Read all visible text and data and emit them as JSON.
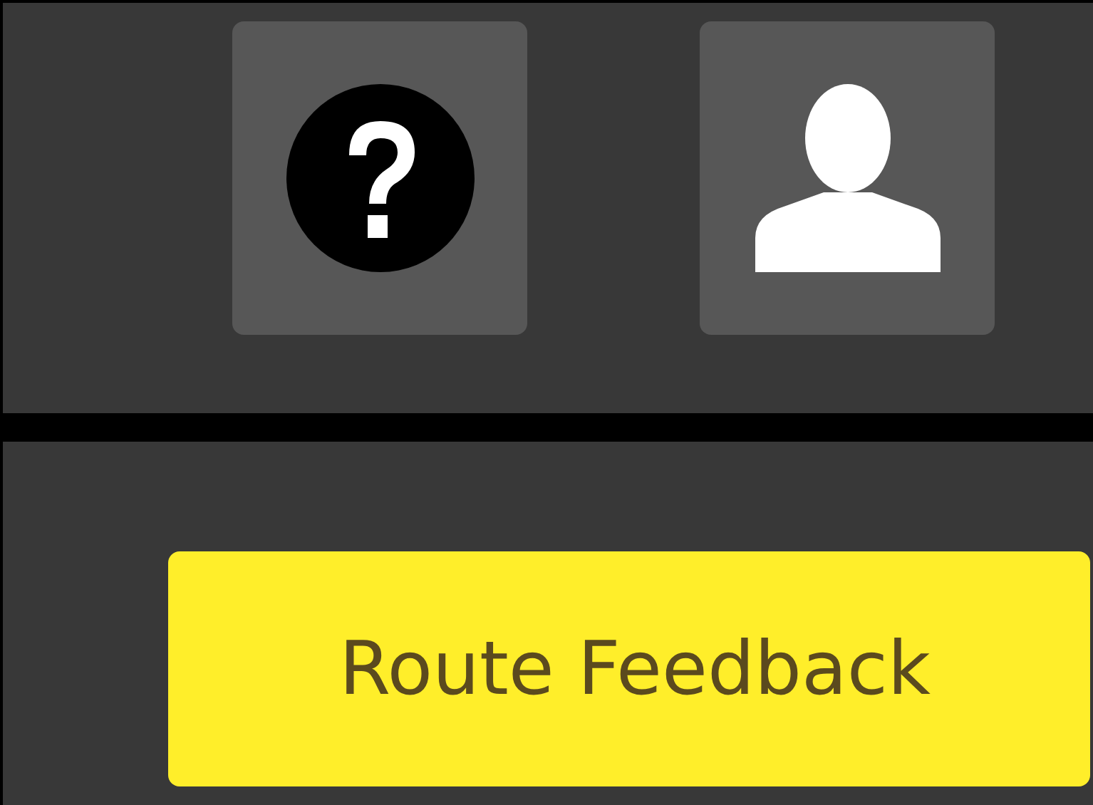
{
  "header": {
    "buttons": [
      {
        "kind": "help"
      },
      {
        "kind": "account"
      }
    ]
  },
  "feedback_button": {
    "label": "Route Feedback"
  }
}
